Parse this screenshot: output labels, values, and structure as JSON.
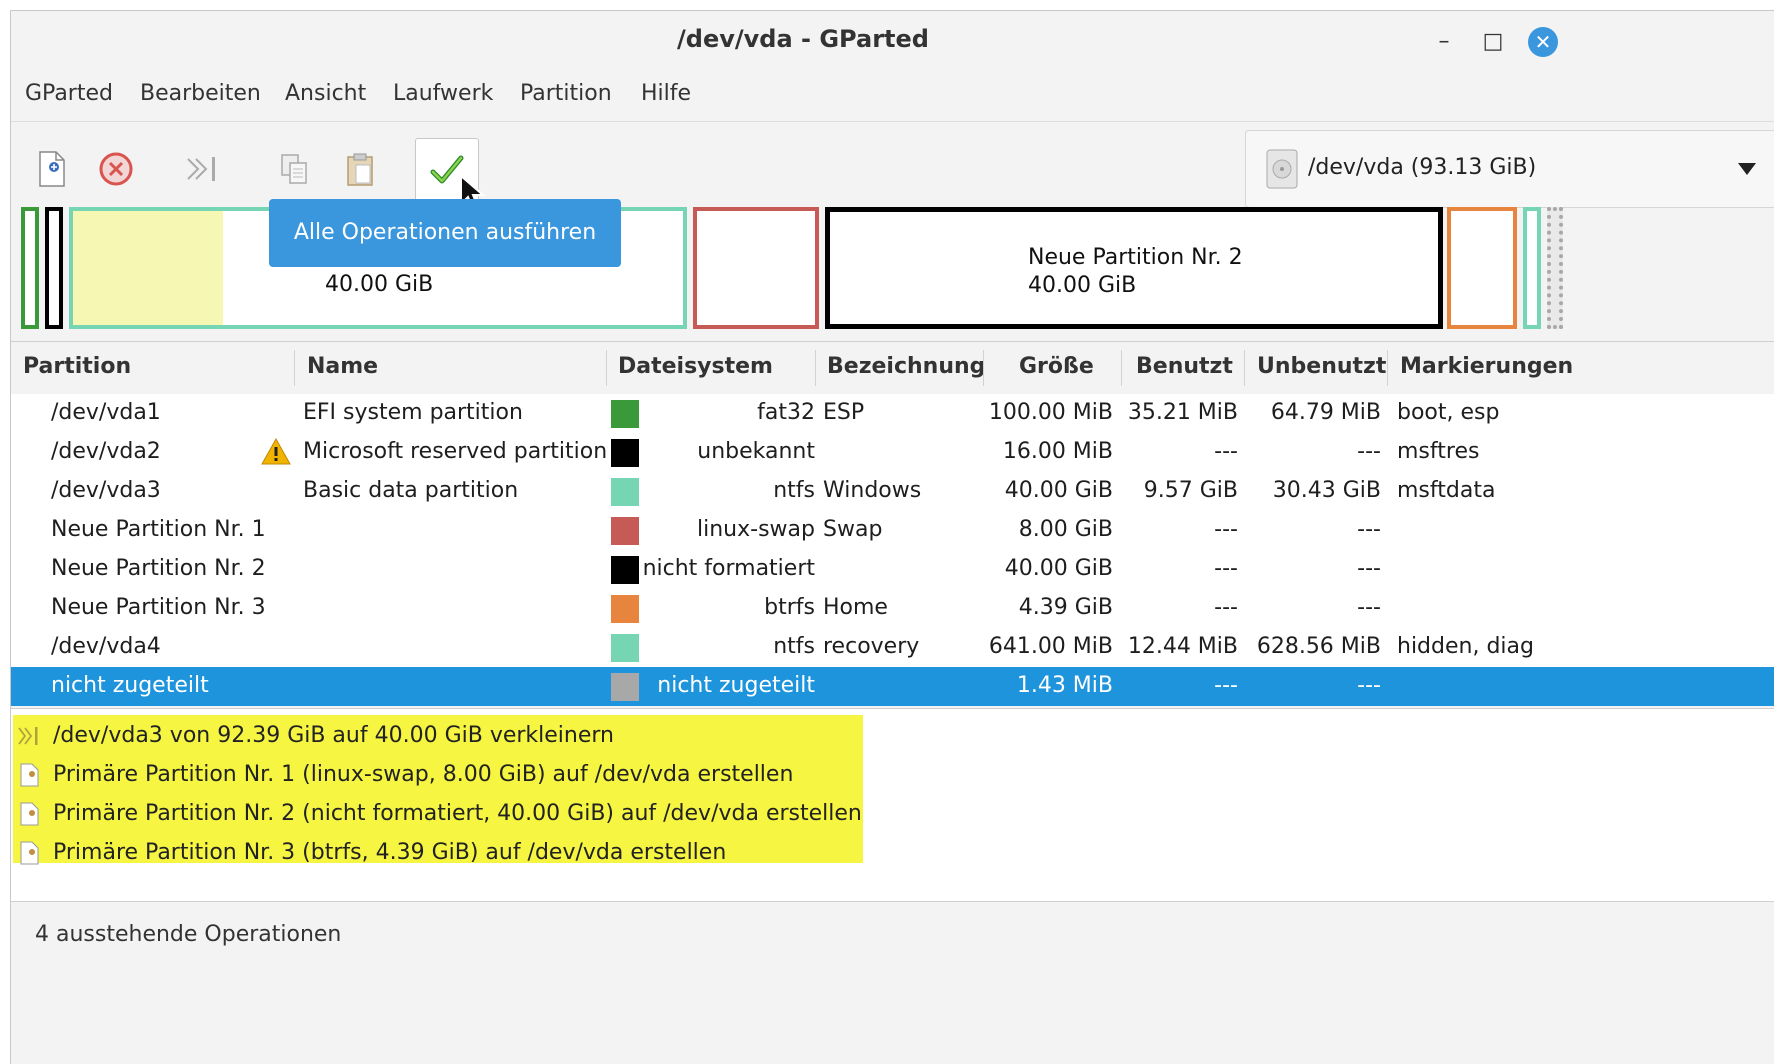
{
  "window": {
    "title": "/dev/vda - GParted",
    "minimize": "–",
    "maximize": "□",
    "close": "✕"
  },
  "menu": [
    "GParted",
    "Bearbeiten",
    "Ansicht",
    "Laufwerk",
    "Partition",
    "Hilfe"
  ],
  "toolbar": {
    "buttons": [
      "new-icon",
      "delete-icon",
      "resize-icon",
      "copy-icon",
      "paste-icon",
      "apply-icon"
    ],
    "tooltip": "Alle Operationen ausführen",
    "device": "/dev/vda  (93.13 GiB)"
  },
  "graph": {
    "vda3_size": "40.00 GiB",
    "new2_name": "Neue Partition Nr. 2",
    "new2_size": "40.00 GiB"
  },
  "columns": [
    "Partition",
    "Name",
    "Dateisystem",
    "Bezeichnung",
    "Größe",
    "Benutzt",
    "Unbenutzt",
    "Markierungen"
  ],
  "rows": [
    {
      "partition": "/dev/vda1",
      "name": "EFI system partition",
      "fs": "fat32",
      "label": "ESP",
      "size": "100.00 MiB",
      "used": "35.21 MiB",
      "unused": "64.79 MiB",
      "flags": "boot, esp",
      "color": "#3a9a3a"
    },
    {
      "partition": "/dev/vda2",
      "name": "Microsoft reserved partition",
      "fs": "unbekannt",
      "label": "",
      "size": "16.00 MiB",
      "used": "---",
      "unused": "---",
      "flags": "msftres",
      "color": "#000000"
    },
    {
      "partition": "/dev/vda3",
      "name": "Basic data partition",
      "fs": "ntfs",
      "label": "Windows",
      "size": "40.00 GiB",
      "used": "9.57 GiB",
      "unused": "30.43 GiB",
      "flags": "msftdata",
      "color": "#76d6b4"
    },
    {
      "partition": "Neue Partition Nr. 1",
      "name": "",
      "fs": "linux-swap",
      "label": "Swap",
      "size": "8.00 GiB",
      "used": "---",
      "unused": "---",
      "flags": "",
      "color": "#c65a54"
    },
    {
      "partition": "Neue Partition Nr. 2",
      "name": "",
      "fs": "nicht formatiert",
      "label": "",
      "size": "40.00 GiB",
      "used": "---",
      "unused": "---",
      "flags": "",
      "color": "#000000"
    },
    {
      "partition": "Neue Partition Nr. 3",
      "name": "",
      "fs": "btrfs",
      "label": "Home",
      "size": "4.39 GiB",
      "used": "---",
      "unused": "---",
      "flags": "",
      "color": "#e7843e"
    },
    {
      "partition": "/dev/vda4",
      "name": "",
      "fs": "ntfs",
      "label": "recovery",
      "size": "641.00 MiB",
      "used": "12.44 MiB",
      "unused": "628.56 MiB",
      "flags": "hidden, diag",
      "color": "#76d6b4"
    },
    {
      "partition": "nicht zugeteilt",
      "name": "",
      "fs": "nicht zugeteilt",
      "label": "",
      "size": "1.43 MiB",
      "used": "---",
      "unused": "---",
      "flags": "",
      "color": "#a8a8a8"
    }
  ],
  "operations": [
    "/dev/vda3 von 92.39 GiB auf 40.00 GiB verkleinern",
    "Primäre Partition Nr. 1 (linux-swap, 8.00 GiB) auf /dev/vda erstellen",
    "Primäre Partition Nr. 2 (nicht formatiert, 40.00 GiB) auf /dev/vda erstellen",
    "Primäre Partition Nr. 3 (btrfs, 4.39 GiB) auf /dev/vda erstellen"
  ],
  "status": "4 ausstehende Operationen"
}
